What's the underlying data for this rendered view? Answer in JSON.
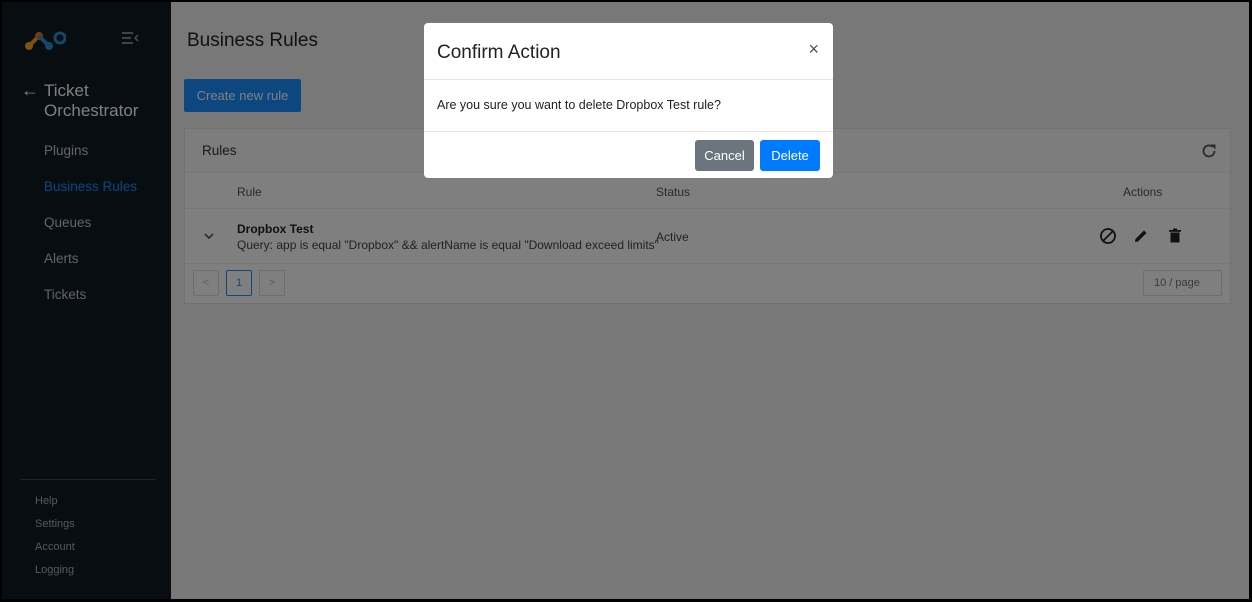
{
  "sidebar": {
    "back_arrow": "←",
    "app_title": "Ticket Orchestrator",
    "nav": [
      {
        "label": "Plugins",
        "active": false
      },
      {
        "label": "Business Rules",
        "active": true
      },
      {
        "label": "Queues",
        "active": false
      },
      {
        "label": "Alerts",
        "active": false
      },
      {
        "label": "Tickets",
        "active": false
      }
    ],
    "footer": [
      "Help",
      "Settings",
      "Account",
      "Logging"
    ]
  },
  "main": {
    "title": "Business Rules",
    "create_button": "Create new rule",
    "card_title": "Rules",
    "columns": {
      "rule": "Rule",
      "status": "Status",
      "actions": "Actions"
    },
    "rows": [
      {
        "name": "Dropbox Test",
        "query": "Query: app is equal \"Dropbox\" && alertName is equal \"Download exceed limits\"",
        "status": "Active"
      }
    ],
    "pagination": {
      "prev": "<",
      "page": "1",
      "next": ">",
      "page_size": "10 / page"
    }
  },
  "modal": {
    "title": "Confirm Action",
    "close": "×",
    "message": "Are you sure you want to delete Dropbox Test rule?",
    "cancel": "Cancel",
    "delete": "Delete"
  },
  "colors": {
    "sidebar_bg": "#0f1a22",
    "accent": "#1890ff",
    "delete_btn": "#007bff",
    "cancel_btn": "#6c757d"
  }
}
